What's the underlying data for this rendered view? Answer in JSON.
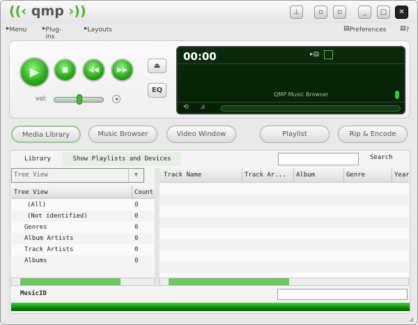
{
  "app": {
    "logo": "qmp"
  },
  "titlebar": {
    "buttons": [
      "pin-icon",
      "mini-icon",
      "restore-icon",
      "minimize-icon",
      "maximize-icon",
      "close-icon"
    ]
  },
  "menubar": {
    "menu": "Menu",
    "plugins": "Plug-ins",
    "layouts": "Layouts",
    "preferences": "Preferences",
    "help": "?"
  },
  "player": {
    "vol_label": "vol:",
    "volume": 0.5,
    "eq": "EQ",
    "eject": "⏏",
    "time": "00:00",
    "status": "QMP Music Browser",
    "progress": 0
  },
  "tabs": [
    "Media Library",
    "Music Browser",
    "Video Window",
    "Playlist",
    "Rip & Encode"
  ],
  "library": {
    "tab_library": "Library",
    "tab_playlists": "Show Playlists and Devices",
    "search_label": "Search",
    "search_value": "",
    "view_select": "Tree View",
    "tree_header": "Tree View",
    "count_header": "Count",
    "tree": [
      {
        "label": "(All)",
        "count": "0"
      },
      {
        "label": "(Not identified)",
        "count": "0"
      },
      {
        "label": "Genres",
        "count": "0"
      },
      {
        "label": "Album Artists",
        "count": "0"
      },
      {
        "label": "Track Artists",
        "count": "0"
      },
      {
        "label": "Albums",
        "count": "0"
      }
    ],
    "columns": [
      "Track Name",
      "Track Ar...",
      "Album",
      "Genre",
      "Year"
    ],
    "musicid_label": "MusicID",
    "musicid_value": ""
  },
  "colors": {
    "accent": "#2aa81a",
    "display": "#062006"
  }
}
